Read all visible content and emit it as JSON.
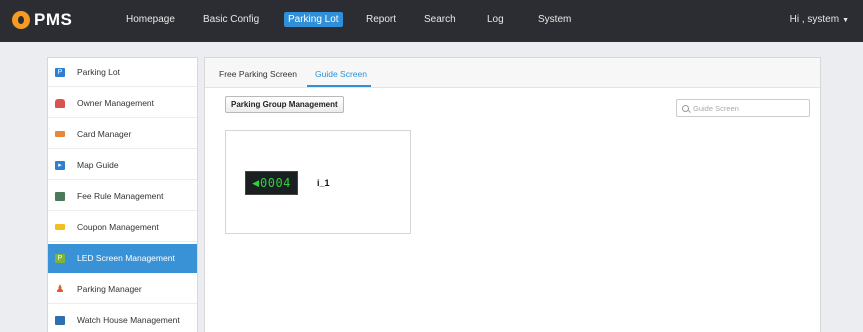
{
  "app": {
    "logo_text": "PMS"
  },
  "nav": {
    "items": [
      {
        "label": "Homepage"
      },
      {
        "label": "Basic Config"
      },
      {
        "label": "Parking Lot",
        "active": true
      },
      {
        "label": "Report"
      },
      {
        "label": "Search"
      },
      {
        "label": "Log"
      },
      {
        "label": "System"
      }
    ],
    "user_label": "Hi , system"
  },
  "sidebar": {
    "items": [
      {
        "label": "Parking Lot",
        "icon": "parking-icon",
        "color": "#2f7fd0"
      },
      {
        "label": "Owner Management",
        "icon": "car-icon",
        "color": "#d9534f"
      },
      {
        "label": "Card Manager",
        "icon": "card-icon",
        "color": "#e8873a"
      },
      {
        "label": "Map Guide",
        "icon": "map-icon",
        "color": "#2f7fd0"
      },
      {
        "label": "Fee Rule Management",
        "icon": "fee-icon",
        "color": "#4a7a5a"
      },
      {
        "label": "Coupon Management",
        "icon": "coupon-icon",
        "color": "#f0c020"
      },
      {
        "label": "LED Screen Management",
        "icon": "led-screen-icon",
        "color": "#7fb33a",
        "active": true
      },
      {
        "label": "Parking Manager",
        "icon": "manager-icon",
        "color": "#e05a2a"
      },
      {
        "label": "Watch House Management",
        "icon": "watch-house-icon",
        "color": "#2f6fb0"
      }
    ]
  },
  "main": {
    "tabs": [
      {
        "label": "Free Parking Screen"
      },
      {
        "label": "Guide Screen",
        "active": true
      }
    ],
    "group_button": "Parking Group Management",
    "search_placeholder": "Guide Screen",
    "screens": [
      {
        "display": "0004",
        "name": "i_1"
      }
    ]
  },
  "colors": {
    "topbar": "#2b2d32",
    "accent": "#2f8fd8",
    "led_green": "#2fd13a"
  }
}
